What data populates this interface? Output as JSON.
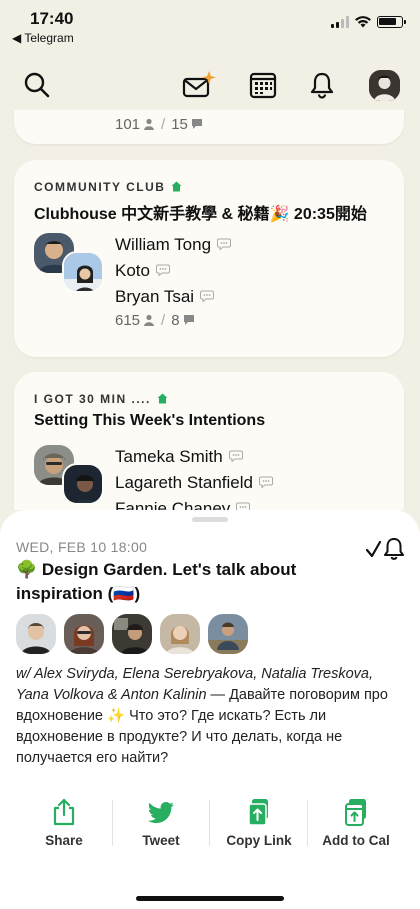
{
  "status_bar": {
    "time": "17:40",
    "back_app": "◀ Telegram"
  },
  "toolbar": {
    "icons": [
      "search-icon",
      "invite-envelope-icon",
      "calendar-icon",
      "bell-icon",
      "profile-avatar"
    ]
  },
  "feed": {
    "partial_card": {
      "listeners": "101",
      "speakers": "15"
    },
    "cards": [
      {
        "club": "COMMUNITY CLUB",
        "title": "Clubhouse 中文新手教學 & 秘籍🎉 20:35開始",
        "speakers": [
          "William Tong",
          "Koto",
          "Bryan Tsai"
        ],
        "listeners": "615",
        "speaker_count": "8"
      },
      {
        "club": "I GOT 30 MIN ....",
        "title": "Setting This Week's Intentions",
        "speakers": [
          "Tameka Smith",
          "Lagareth Stanfield",
          "Fannie Chaney"
        ]
      }
    ]
  },
  "event": {
    "date": "WED, FEB 10 18:00",
    "title": "🌳 Design Garden. Let's talk about inspiration (🇷🇺)",
    "hosts_line": "w/ Alex Sviryda, Elena Serebryakova, Natalia Treskova, Yana Volkova & Anton Kalinin",
    "description": " — Давайте поговорим про вдохновение ✨ Что это? Где искать? Есть ли вдохновение в продукте? И что делать, когда не получается его найти?",
    "actions": [
      {
        "label": "Share",
        "icon": "share-icon"
      },
      {
        "label": "Tweet",
        "icon": "twitter-icon"
      },
      {
        "label": "Copy Link",
        "icon": "copy-link-icon"
      },
      {
        "label": "Add to Cal",
        "icon": "add-to-calendar-icon"
      }
    ]
  },
  "colors": {
    "background": "#f2efe4",
    "card": "#fcfbf6",
    "accent_green": "#27ae60",
    "sheet": "#ffffff"
  }
}
